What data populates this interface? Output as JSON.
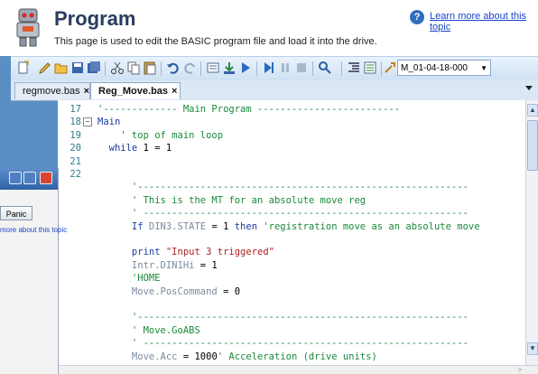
{
  "header": {
    "title": "Program",
    "subtitle": "This page is used to edit the BASIC program file  and load it into the drive.",
    "help_link": "Learn more about this topic"
  },
  "toolbar": {
    "combo_value": "M_01-04-18-000",
    "icons": [
      "new-file-icon",
      "edit-icon",
      "open-folder-icon",
      "save-icon",
      "save-all-icon",
      "cut-icon",
      "copy-icon",
      "paste-icon",
      "undo-icon",
      "redo-icon",
      "compile-icon",
      "download-icon",
      "run-icon",
      "step-icon",
      "pause-icon",
      "stop-icon",
      "search-icon",
      "outdent-icon",
      "indent-icon",
      "properties-icon"
    ]
  },
  "tabs": [
    {
      "label": "regmove.bas",
      "close": "×",
      "active": false
    },
    {
      "label": "Reg_Move.bas",
      "close": "×",
      "active": true
    }
  ],
  "editor": {
    "lines": [
      {
        "num": "17",
        "fold": "",
        "segments": [
          {
            "t": "'------------- Main Program -------------------------",
            "c": "c-green"
          }
        ]
      },
      {
        "num": "18",
        "fold": "−",
        "segments": [
          {
            "t": "Main",
            "c": "c-blue"
          }
        ]
      },
      {
        "num": "19",
        "fold": "",
        "segments": [
          {
            "t": "    ' top of main loop",
            "c": "c-green"
          }
        ]
      },
      {
        "num": "20",
        "fold": "",
        "segments": [
          {
            "t": "  while ",
            "c": "c-blue"
          },
          {
            "t": "1 = 1",
            "c": "c-black"
          }
        ]
      },
      {
        "num": "21",
        "fold": "",
        "segments": []
      },
      {
        "num": "22",
        "fold": "",
        "segments": []
      },
      {
        "num": "",
        "fold": "",
        "segments": [
          {
            "t": "      '----------------------------------------------------------",
            "c": "c-green"
          }
        ]
      },
      {
        "num": "",
        "fold": "",
        "segments": [
          {
            "t": "      ' This is the MT for an absolute move reg",
            "c": "c-green"
          }
        ]
      },
      {
        "num": "",
        "fold": "",
        "segments": [
          {
            "t": "      ' ---------------------------------------------------------",
            "c": "c-green"
          }
        ]
      },
      {
        "num": "",
        "fold": "",
        "segments": [
          {
            "t": "      If ",
            "c": "c-blue"
          },
          {
            "t": "DIN3.STATE",
            "c": "c-gray"
          },
          {
            "t": " = 1 ",
            "c": "c-black"
          },
          {
            "t": "then ",
            "c": "c-blue"
          },
          {
            "t": "'registration move as an absolute move",
            "c": "c-green"
          }
        ]
      },
      {
        "num": "",
        "fold": "",
        "segments": []
      },
      {
        "num": "",
        "fold": "",
        "segments": [
          {
            "t": "      print ",
            "c": "c-blue"
          },
          {
            "t": "\"Input 3 triggered\"",
            "c": "c-red"
          }
        ]
      },
      {
        "num": "",
        "fold": "",
        "segments": [
          {
            "t": "      Intr.DIN1Hi",
            "c": "c-gray"
          },
          {
            "t": " = 1",
            "c": "c-black"
          }
        ]
      },
      {
        "num": "",
        "fold": "",
        "segments": [
          {
            "t": "      'HOME",
            "c": "c-green"
          }
        ]
      },
      {
        "num": "",
        "fold": "",
        "segments": [
          {
            "t": "      Move.PosCommand",
            "c": "c-gray"
          },
          {
            "t": " = 0",
            "c": "c-black"
          }
        ]
      },
      {
        "num": "",
        "fold": "",
        "segments": []
      },
      {
        "num": "",
        "fold": "",
        "segments": [
          {
            "t": "      '----------------------------------------------------------",
            "c": "c-green"
          }
        ]
      },
      {
        "num": "",
        "fold": "",
        "segments": [
          {
            "t": "      ' Move.GoABS",
            "c": "c-green"
          }
        ]
      },
      {
        "num": "",
        "fold": "",
        "segments": [
          {
            "t": "      ' ---------------------------------------------------------",
            "c": "c-green"
          }
        ]
      },
      {
        "num": "",
        "fold": "",
        "segments": [
          {
            "t": "      Move.Acc",
            "c": "c-gray"
          },
          {
            "t": " = 1000",
            "c": "c-black"
          },
          {
            "t": "' Acceleration (drive units)",
            "c": "c-green"
          }
        ]
      }
    ]
  },
  "overlay": {
    "panic_label": "Panic",
    "link_text": "more about this topic"
  }
}
